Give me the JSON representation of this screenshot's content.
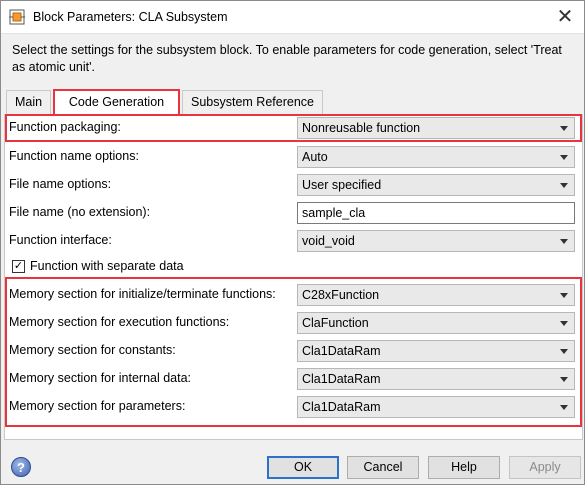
{
  "window": {
    "title": "Block Parameters: CLA Subsystem",
    "close_glyph": "✕",
    "icon": "simulink-block-icon"
  },
  "description": "Select the settings for the subsystem block. To enable parameters for code generation, select 'Treat as atomic unit'.",
  "tabs": [
    {
      "label": "Main",
      "active": false
    },
    {
      "label": "Code Generation",
      "active": true
    },
    {
      "label": "Subsystem Reference",
      "active": false
    }
  ],
  "params": {
    "function_packaging": {
      "label": "Function packaging:",
      "value": "Nonreusable function"
    },
    "function_name_options": {
      "label": "Function name options:",
      "value": "Auto"
    },
    "file_name_options": {
      "label": "File name options:",
      "value": "User specified"
    },
    "file_name": {
      "label": "File name (no extension):",
      "value": "sample_cla"
    },
    "function_interface": {
      "label": "Function interface:",
      "value": "void_void"
    },
    "separate_data": {
      "label": "Function with separate data",
      "checked": true,
      "check_glyph": "✓"
    },
    "mem_init_term": {
      "label": "Memory section for initialize/terminate functions:",
      "value": "C28xFunction"
    },
    "mem_exec": {
      "label": "Memory section for execution functions:",
      "value": "ClaFunction"
    },
    "mem_constants": {
      "label": "Memory section for constants:",
      "value": "Cla1DataRam"
    },
    "mem_internal": {
      "label": "Memory section for internal data:",
      "value": "Cla1DataRam"
    },
    "mem_params": {
      "label": "Memory section for parameters:",
      "value": "Cla1DataRam"
    }
  },
  "footer": {
    "help_glyph": "?",
    "ok": "OK",
    "cancel": "Cancel",
    "help": "Help",
    "apply": "Apply"
  },
  "colors": {
    "highlight": "#e8353d",
    "default_button_border": "#2e71c9"
  }
}
